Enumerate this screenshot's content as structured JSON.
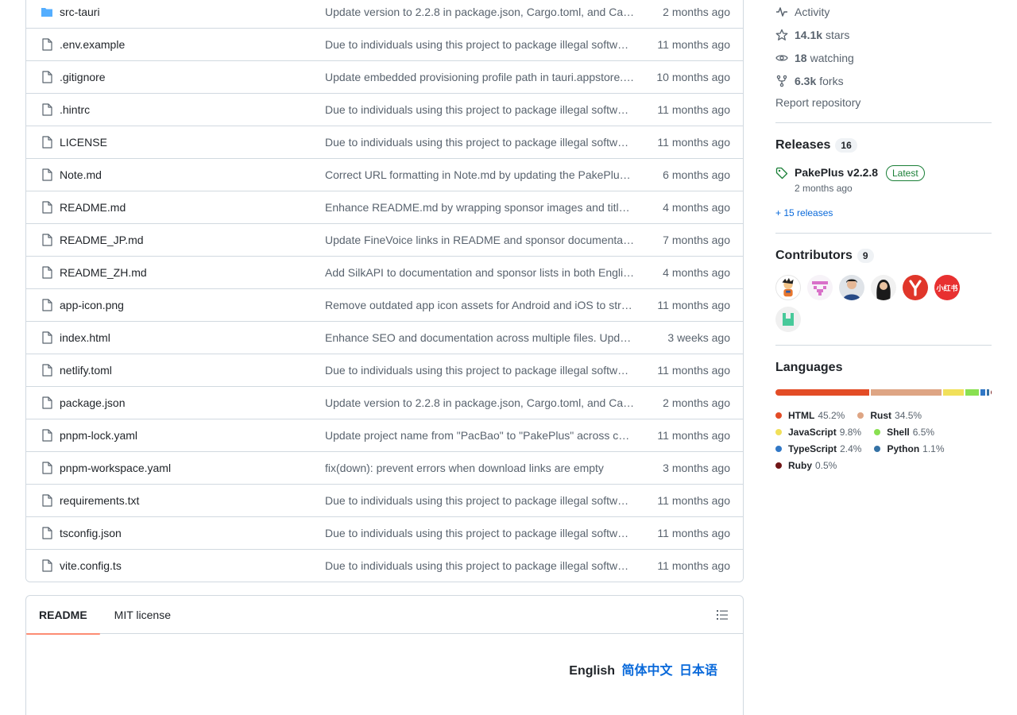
{
  "files": [
    {
      "name": "src-tauri",
      "type": "dir",
      "message": "Update version to 2.2.8 in package.json, Cargo.toml, and Ca…",
      "time": "2 months ago"
    },
    {
      "name": ".env.example",
      "type": "file",
      "message": "Due to individuals using this project to package illegal softw…",
      "time": "11 months ago"
    },
    {
      "name": ".gitignore",
      "type": "file",
      "message": "Update embedded provisioning profile path in tauri.appstore.…",
      "time": "10 months ago"
    },
    {
      "name": ".hintrc",
      "type": "file",
      "message": "Due to individuals using this project to package illegal softw…",
      "time": "11 months ago"
    },
    {
      "name": "LICENSE",
      "type": "file",
      "message": "Due to individuals using this project to package illegal softw…",
      "time": "11 months ago"
    },
    {
      "name": "Note.md",
      "type": "file",
      "message": "Correct URL formatting in Note.md by updating the PakePlu…",
      "time": "6 months ago"
    },
    {
      "name": "README.md",
      "type": "file",
      "message": "Enhance README.md by wrapping sponsor images and titl…",
      "time": "4 months ago"
    },
    {
      "name": "README_JP.md",
      "type": "file",
      "message": "Update FineVoice links in README and sponsor documenta…",
      "time": "7 months ago"
    },
    {
      "name": "README_ZH.md",
      "type": "file",
      "message": "Add SilkAPI to documentation and sponsor lists in both Engli…",
      "time": "4 months ago"
    },
    {
      "name": "app-icon.png",
      "type": "file",
      "message": "Remove outdated app icon assets for Android and iOS to str…",
      "time": "11 months ago"
    },
    {
      "name": "index.html",
      "type": "file",
      "message": "Enhance SEO and documentation across multiple files. Upd…",
      "time": "3 weeks ago"
    },
    {
      "name": "netlify.toml",
      "type": "file",
      "message": "Due to individuals using this project to package illegal softw…",
      "time": "11 months ago"
    },
    {
      "name": "package.json",
      "type": "file",
      "message": "Update version to 2.2.8 in package.json, Cargo.toml, and Ca…",
      "time": "2 months ago"
    },
    {
      "name": "pnpm-lock.yaml",
      "type": "file",
      "message": "Update project name from \"PacBao\" to \"PakePlus\" across c…",
      "time": "11 months ago"
    },
    {
      "name": "pnpm-workspace.yaml",
      "type": "file",
      "message": "fix(down): prevent errors when download links are empty",
      "time": "3 months ago"
    },
    {
      "name": "requirements.txt",
      "type": "file",
      "message": "Due to individuals using this project to package illegal softw…",
      "time": "11 months ago"
    },
    {
      "name": "tsconfig.json",
      "type": "file",
      "message": "Due to individuals using this project to package illegal softw…",
      "time": "11 months ago"
    },
    {
      "name": "vite.config.ts",
      "type": "file",
      "message": "Due to individuals using this project to package illegal softw…",
      "time": "11 months ago"
    }
  ],
  "readme": {
    "tab_readme": "README",
    "tab_license": "MIT license",
    "lang_current": "English",
    "lang_zh": "简体中文",
    "lang_jp": "日本语"
  },
  "about": {
    "activity": "Activity",
    "stars_count": "14.1k",
    "stars_label": "stars",
    "watching_count": "18",
    "watching_label": "watching",
    "forks_count": "6.3k",
    "forks_label": "forks",
    "report": "Report repository"
  },
  "releases": {
    "title": "Releases",
    "count": "16",
    "latest_name": "PakePlus v2.2.8",
    "latest_badge": "Latest",
    "latest_time": "2 months ago",
    "more": "+ 15 releases"
  },
  "contributors": {
    "title": "Contributors",
    "count": "9",
    "avatar_5_text": "小红书"
  },
  "languages": {
    "title": "Languages",
    "items": [
      {
        "name": "HTML",
        "pct": "45.2%",
        "value": 45.2,
        "color": "#e34c26"
      },
      {
        "name": "Rust",
        "pct": "34.5%",
        "value": 34.5,
        "color": "#dea584"
      },
      {
        "name": "JavaScript",
        "pct": "9.8%",
        "value": 9.8,
        "color": "#f1e05a"
      },
      {
        "name": "Shell",
        "pct": "6.5%",
        "value": 6.5,
        "color": "#89e051"
      },
      {
        "name": "TypeScript",
        "pct": "2.4%",
        "value": 2.4,
        "color": "#3178c6"
      },
      {
        "name": "Python",
        "pct": "1.1%",
        "value": 1.1,
        "color": "#3572a5"
      },
      {
        "name": "Ruby",
        "pct": "0.5%",
        "value": 0.5,
        "color": "#701516"
      }
    ]
  }
}
